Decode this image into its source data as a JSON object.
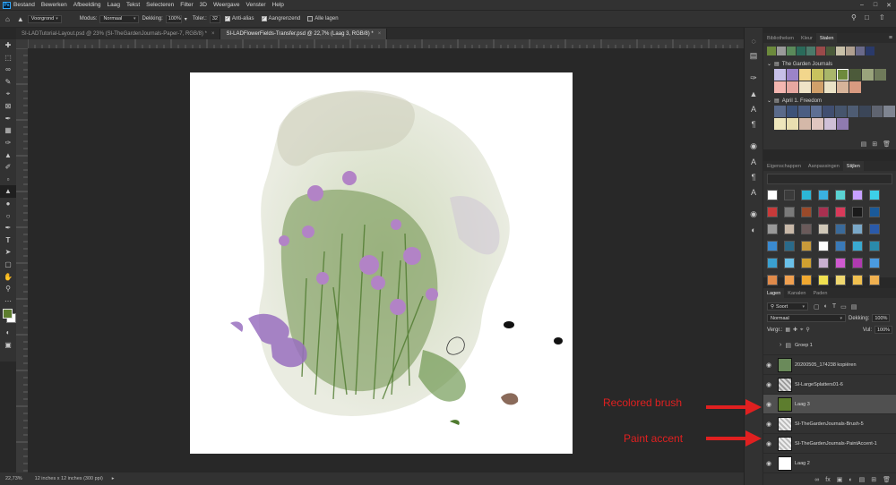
{
  "menubar": {
    "items": [
      "Bestand",
      "Bewerken",
      "Afbeelding",
      "Laag",
      "Tekst",
      "Selecteren",
      "Filter",
      "3D",
      "Weergave",
      "Venster",
      "Help"
    ],
    "app_icon": "photoshop-icon"
  },
  "options": {
    "preset": "Voorgrond",
    "mode_label": "Modus:",
    "mode_value": "Normaal",
    "opacity_label": "Dekking:",
    "opacity_value": "100%",
    "tolerance_label": "Toler.:",
    "tolerance_value": "32",
    "antialias_label": "Anti-alias",
    "contiguous_label": "Aangrenzend",
    "alllayers_label": "Alle lagen"
  },
  "tabs": [
    {
      "label": "SI-LADTutorial-Layout.psd @ 23% (SI-TheGardenJournals-Paper-7, RGB/8) *"
    },
    {
      "label": "SI-LADFlowerFields-Transfer.psd @ 22,7% (Laag 3, RGB/8) *"
    }
  ],
  "status": {
    "zoom": "22,73%",
    "doc_size": "12 inches x 12 inches (300 ppi)"
  },
  "swatches_panel": {
    "tabs": [
      "Bibliotheken",
      "Kleur",
      "Stalen"
    ],
    "groups": [
      {
        "name": "The Garden Journals",
        "rows": [
          [
            "#c7c0e8",
            "#9b84c8",
            "#f2d68c",
            "#c8c25e",
            "#a9b66a",
            "#6e8a3c",
            "#4c5a3a",
            "#9aa47c",
            "#6f7a5a"
          ],
          [
            "#f4b6b0",
            "#e6a7a0",
            "#efe3c7",
            "#d0a06a",
            "#eae2c6",
            "#d7b49a",
            "#d89a80"
          ]
        ]
      },
      {
        "name": "April 1. Freedom",
        "rows": [
          [
            "#5a6a8a",
            "#3d5278",
            "#4b5d82",
            "#5e6f93",
            "#404e70",
            "#46556d",
            "#4e5c73",
            "#3b4658",
            "#5f6470",
            "#7f8591"
          ],
          [
            "#eee6bc",
            "#e9dfb0",
            "#d4b8a8",
            "#e0c6c0",
            "#cfc0d8",
            "#8f7bb0"
          ]
        ]
      }
    ]
  },
  "styles_panel": {
    "tabs": [
      "Eigenschappen",
      "Aanpassingen",
      "Stijlen"
    ],
    "tiles": [
      "#ffffff",
      "#3b3b3b",
      "#2cb6d6",
      "#3ab1e2",
      "#5ad2d2",
      "#c7a0ff",
      "#3dd0e8",
      "#c83a3a",
      "#7a7a7a",
      "#9a4a2a",
      "#a83050",
      "#d83a5a",
      "#1a1a1a",
      "#1a5a9a",
      "#999999",
      "#c8b8a8",
      "#6a5a5a",
      "#d0c8b8",
      "#3a6a9a",
      "#7aa8c8",
      "#2a5aaa",
      "#3a8ad0",
      "#2a6a8a",
      "#c89a3a",
      "#ffffff",
      "#3a7ab8",
      "#3aaad0",
      "#2a8aaa",
      "#3aa0d0",
      "#6ac0e8",
      "#d0a030",
      "#c8b0d0",
      "#d05ad0",
      "#b03ab0",
      "#4a9ae0",
      "#e08a4a",
      "#f0a050",
      "#f0a830",
      "#f0e050",
      "#f0d870",
      "#f0c050",
      "#f0b050"
    ]
  },
  "layers_panel": {
    "tabs": [
      "Lagen",
      "Kanalen",
      "Paden"
    ],
    "kind_filter": "Soort",
    "blend_mode": "Normaal",
    "opacity_label": "Dekking:",
    "opacity_value": "100%",
    "lock_label": "Vergr.:",
    "fill_label": "Vul:",
    "fill_value": "100%",
    "layers": [
      {
        "name": "Groep 1",
        "visible": false,
        "kind": "group"
      },
      {
        "name": "20200505_174238 kopiëren",
        "visible": true,
        "kind": "photo"
      },
      {
        "name": "SI-LargeSplatters01-6",
        "visible": true,
        "kind": "splatter"
      },
      {
        "name": "Laag 3",
        "visible": true,
        "kind": "green",
        "selected": true
      },
      {
        "name": "SI-TheGardenJournals-Brush-5",
        "visible": true,
        "kind": "brush"
      },
      {
        "name": "SI-TheGardenJournals-PaintAccent-1",
        "visible": true,
        "kind": "brush"
      },
      {
        "name": "Laag 2",
        "visible": true,
        "kind": "white"
      }
    ]
  },
  "annotations": [
    {
      "text": "Recolored brush"
    },
    {
      "text": "Paint accent"
    }
  ],
  "colors": {
    "accent_red": "#e02020",
    "foreground": "#5d7d2e",
    "background": "#ffffff"
  }
}
